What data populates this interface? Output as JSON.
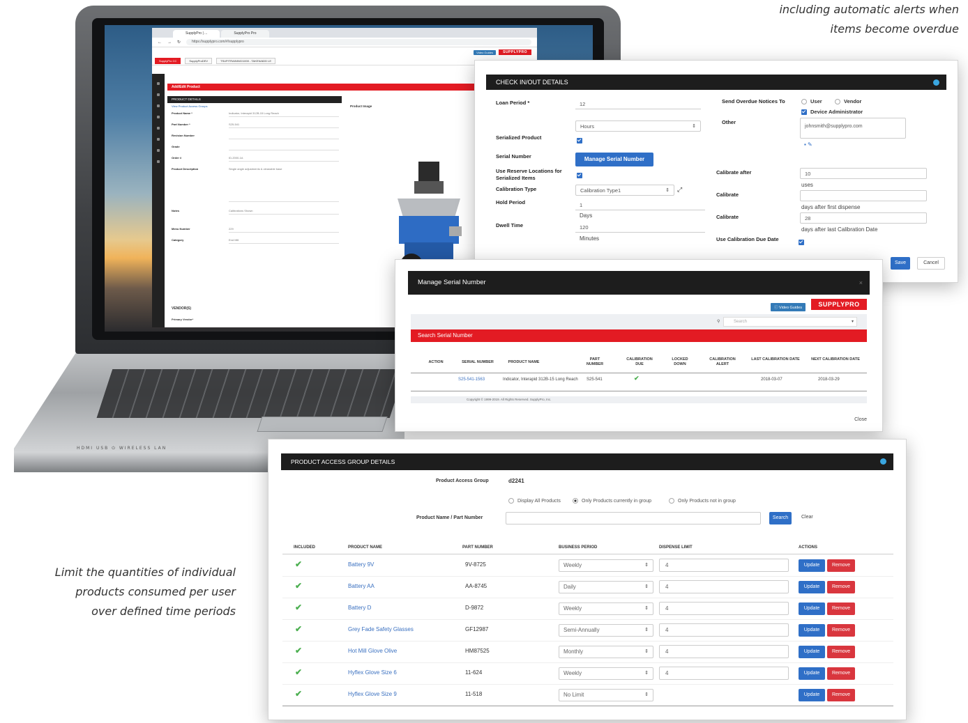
{
  "captions": {
    "top_line1": "including automatic alerts when",
    "top_line2": "items become overdue",
    "left_line1": "Limit the quantities of individual",
    "left_line2": "products consumed per user",
    "left_line3": "over defined time periods"
  },
  "laptop": {
    "ports_label": "HDMI  USB  ⏻  WIRELESS LAN",
    "browser": {
      "tabs": [
        "SupplyPro | ...",
        "SupplyPro Pro"
      ],
      "url": "https://supplypro.com/#/supplypro",
      "video_guides": "Video Guides",
      "logo": "SUPPLYPRO",
      "crumbs": [
        "SupplyPro CC",
        "SupplyProDEV",
        "TSUP/TRAINING/1000 - TAKEN/ADD LE"
      ],
      "page_title": "Add/Edit Product",
      "section": "PRODUCT DETAILS",
      "access_link": "View Product Access Groups",
      "image_label": "Product Image",
      "form": [
        {
          "label": "Product Name *",
          "value": "Indicator, Interapid 312B-15 Long Reach"
        },
        {
          "label": "Part Number *",
          "value": "S25-541"
        },
        {
          "label": "Revision Number",
          "value": ""
        },
        {
          "label": "Grade",
          "value": ""
        },
        {
          "label": "Order #",
          "value": "ID-2000-1A"
        },
        {
          "label": "Product Description",
          "value": "Single angle adjustments & cleanable base"
        },
        {
          "label": "Notes",
          "value": "Calibrations Shown"
        },
        {
          "label": "Menu Number",
          "value": "229"
        },
        {
          "label": "Category",
          "value": "End Mill"
        }
      ],
      "vendors_heading": "VENDOR(S)",
      "primary_vendor_label": "Primary Vendor*"
    }
  },
  "check_modal": {
    "title": "CHECK IN/OUT DETAILS",
    "loan_period_label": "Loan Period *",
    "loan_period_value": "12",
    "loan_unit": "Hours",
    "serialized_label": "Serialized Product",
    "serial_number_label": "Serial Number",
    "manage_serial_button": "Manage Serial Number",
    "reserve_label": "Use Reserve Locations for Serialized Items",
    "calibration_type_label": "Calibration Type",
    "calibration_type_value": "Calibration Type1",
    "hold_period_label": "Hold Period",
    "hold_value": "1",
    "hold_unit": "Days",
    "dwell_label": "Dwell Time",
    "dwell_value": "120",
    "dwell_unit": "Minutes",
    "send_notices_label": "Send Overdue Notices To",
    "opt_user": "User",
    "opt_vendor": "Vendor",
    "opt_device_admin": "Device Administrator",
    "other_label": "Other",
    "other_value": "johnsmith@supplypro.com",
    "calibrate_after_label": "Calibrate after",
    "calibrate_after_value": "10",
    "calibrate_after_unit": "uses",
    "calibrate_label_1": "Calibrate",
    "calibrate_unit_1": "days after first dispense",
    "calibrate_label_2": "Calibrate",
    "calibrate_value_2": "28",
    "calibrate_unit_2": "days after last Calibration Date",
    "due_date_label": "Use Calibration Due Date",
    "save": "Save",
    "cancel": "Cancel"
  },
  "serial_modal": {
    "title": "Manage Serial Number",
    "video_guides": "Video Guides",
    "logo": "SUPPLYPRO",
    "search_placeholder": "Search",
    "search_header": "Search Serial Number",
    "columns": [
      "ACTION",
      "SERIAL NUMBER",
      "PRODUCT NAME",
      "PART NUMBER",
      "CALIBRATION DUE",
      "LOCKED DOWN",
      "CALIBRATION ALERT",
      "LAST CALIBRATION DATE",
      "NEXT CALIBRATION DATE"
    ],
    "row": {
      "serial": "S25-541-1563",
      "product": "Indicator, Interapid 312B-15 Long Reach",
      "part": "S25-541",
      "calibration_due": "✔",
      "last_cal": "2018-03-07",
      "next_cal": "2018-03-29"
    },
    "footer": "Copyright © 1999-2019. All Rights Reserved. SupplyPro, Inc.",
    "close": "Close"
  },
  "access_modal": {
    "title": "PRODUCT ACCESS GROUP DETAILS",
    "group_label": "Product Access Group",
    "group_value": "d2241",
    "filter_all": "Display All Products",
    "filter_in": "Only Products currently in group",
    "filter_out": "Only Products not in group",
    "search_label": "Product Name / Part Number",
    "search_button": "Search",
    "clear_button": "Clear",
    "columns": {
      "included": "INCLUDED",
      "product": "PRODUCT NAME",
      "part": "PART NUMBER",
      "period": "BUSINESS PERIOD",
      "limit": "DISPENSE LIMIT",
      "actions": "ACTIONS"
    },
    "update_label": "Update",
    "remove_label": "Remove",
    "rows": [
      {
        "product": "Battery 9V",
        "part": "9V-8725",
        "period": "Weekly",
        "limit": "4"
      },
      {
        "product": "Battery AA",
        "part": "AA-8745",
        "period": "Daily",
        "limit": "4"
      },
      {
        "product": "Battery D",
        "part": "D-9872",
        "period": "Weekly",
        "limit": "4"
      },
      {
        "product": "Grey Fade Safety Glasses",
        "part": "GF12987",
        "period": "Semi-Annually",
        "limit": "4"
      },
      {
        "product": "Hot Mill Glove Olive",
        "part": "HM87525",
        "period": "Monthly",
        "limit": "4"
      },
      {
        "product": "Hyflex Glove Size 6",
        "part": "11-624",
        "period": "Weekly",
        "limit": "4"
      },
      {
        "product": "Hyflex Glove Size 9",
        "part": "11-518",
        "period": "No Limit",
        "limit": ""
      }
    ]
  },
  "colors": {
    "brand_red": "#e31b23",
    "primary_blue": "#2f6fc7",
    "remove_red": "#d9363e",
    "header_dark": "#1d1d1d",
    "check_green": "#4caf50"
  }
}
